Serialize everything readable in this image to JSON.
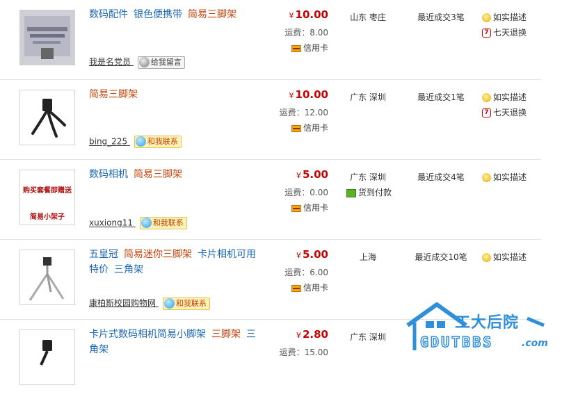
{
  "currency": "¥",
  "listings": [
    {
      "title": [
        {
          "text": "数码配件",
          "hl": false
        },
        {
          "text": "银色便携带",
          "hl": false
        },
        {
          "text": "简易三脚架",
          "hl": true
        }
      ],
      "thumb_text": "",
      "seller": "我是名党员",
      "contact_label": "给我留言",
      "contact_style": "gray",
      "price": "10.00",
      "shipping": "运费：8.00",
      "payment": "信用卡",
      "cod": "",
      "location": "山东 枣庄",
      "recent_deals": "最近成交3笔",
      "services": [
        "如实描述",
        "七天退换"
      ]
    },
    {
      "title": [
        {
          "text": "简易三脚架",
          "hl": true
        }
      ],
      "thumb_text": "",
      "seller": "bing_225",
      "contact_label": "和我联系",
      "contact_style": "yellow",
      "price": "10.00",
      "shipping": "运费：12.00",
      "payment": "信用卡",
      "cod": "",
      "location": "广东 深圳",
      "recent_deals": "最近成交1笔",
      "services": [
        "如实描述",
        "七天退换"
      ]
    },
    {
      "title": [
        {
          "text": "数码相机",
          "hl": false
        },
        {
          "text": "简易三脚架",
          "hl": true
        }
      ],
      "thumb_text_top": "购买套餐即赠送",
      "thumb_text_bottom": "简易小架子",
      "seller": "xuxiong11",
      "contact_label": "和我联系",
      "contact_style": "yellow",
      "price": "5.00",
      "shipping": "运费：0.00",
      "payment": "信用卡",
      "cod": "货到付款",
      "location": "广东 深圳",
      "recent_deals": "最近成交4笔",
      "services": [
        "如实描述"
      ]
    },
    {
      "title": [
        {
          "text": "五皇冠",
          "hl": false
        },
        {
          "text": "简易迷你三脚架",
          "hl": true
        },
        {
          "text": "卡片相机可用",
          "hl": false
        },
        {
          "text": "特价",
          "hl": false
        },
        {
          "text": "三角架",
          "hl": false
        }
      ],
      "seller": "康柏斯校园购物网",
      "contact_label": "和我联系",
      "contact_style": "yellow",
      "price": "5.00",
      "shipping": "运费：6.00",
      "payment": "信用卡",
      "cod": "",
      "location": "上海",
      "recent_deals": "最近成交10笔",
      "services": [
        "如实描述"
      ]
    },
    {
      "title": [
        {
          "text": "卡片式数码相机简易小脚架",
          "hl": false
        },
        {
          "text": "三脚架",
          "hl": true
        },
        {
          "text": "三角架",
          "hl": false
        }
      ],
      "seller": "",
      "price": "2.80",
      "shipping": "运费：15.00",
      "payment": "",
      "cod": "",
      "location": "广东 深圳",
      "recent_deals": "",
      "services": []
    }
  ],
  "watermark": {
    "cn": "工大后院",
    "en": "GDUTBBS",
    "suffix": ".com"
  }
}
